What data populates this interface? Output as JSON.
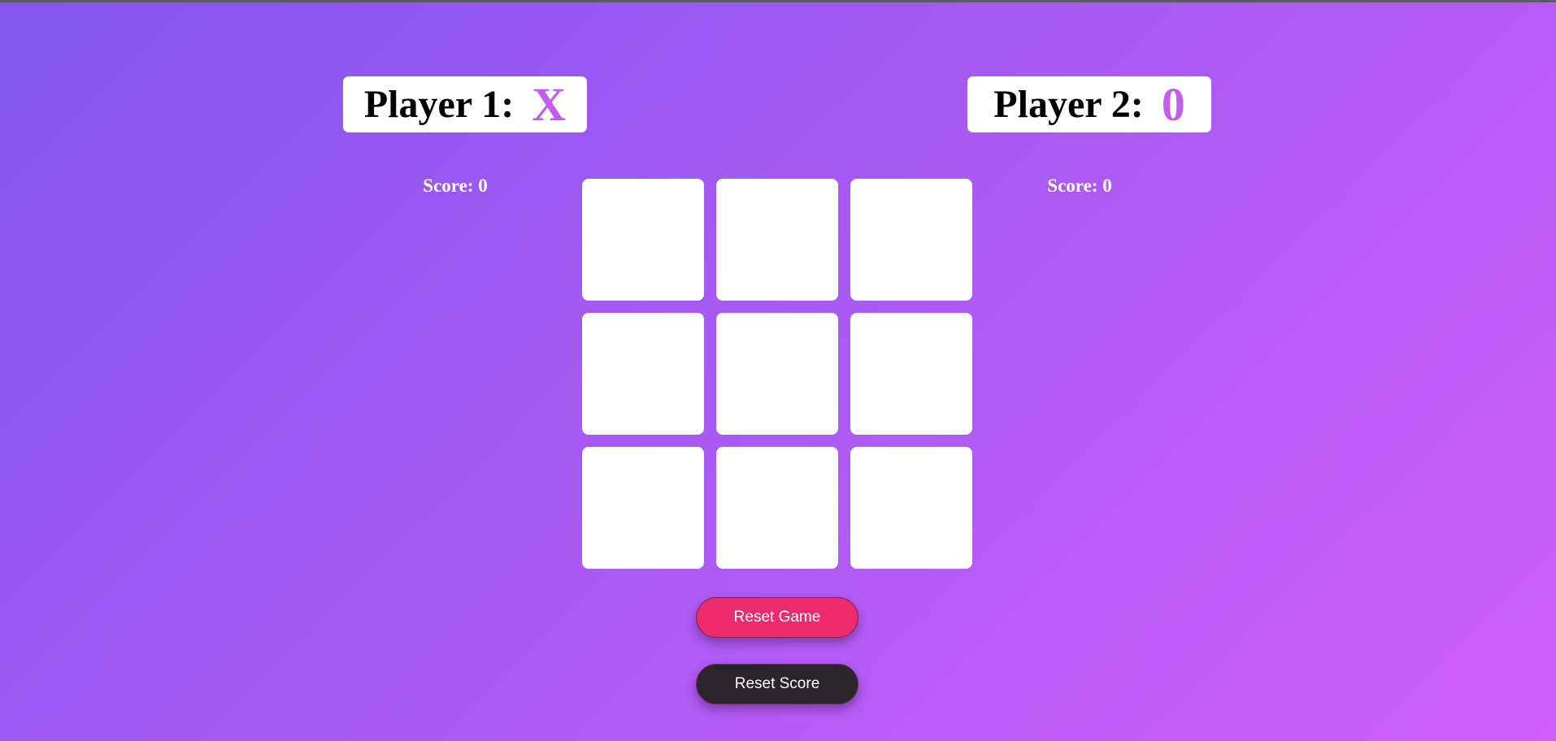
{
  "colors": {
    "background_start": "#8356ee",
    "background_end": "#d05ef9",
    "mark_color": "#c55cf0",
    "reset_game_bg": "#ed2a6b",
    "reset_score_bg": "#2a2528"
  },
  "players": [
    {
      "label": "Player 1:",
      "mark": "X",
      "score_text": "Score: 0"
    },
    {
      "label": "Player 2:",
      "mark": "0",
      "score_text": "Score: 0"
    }
  ],
  "board": {
    "cells": [
      "",
      "",
      "",
      "",
      "",
      "",
      "",
      "",
      ""
    ]
  },
  "buttons": {
    "reset_game": "Reset Game",
    "reset_score": "Reset Score"
  }
}
